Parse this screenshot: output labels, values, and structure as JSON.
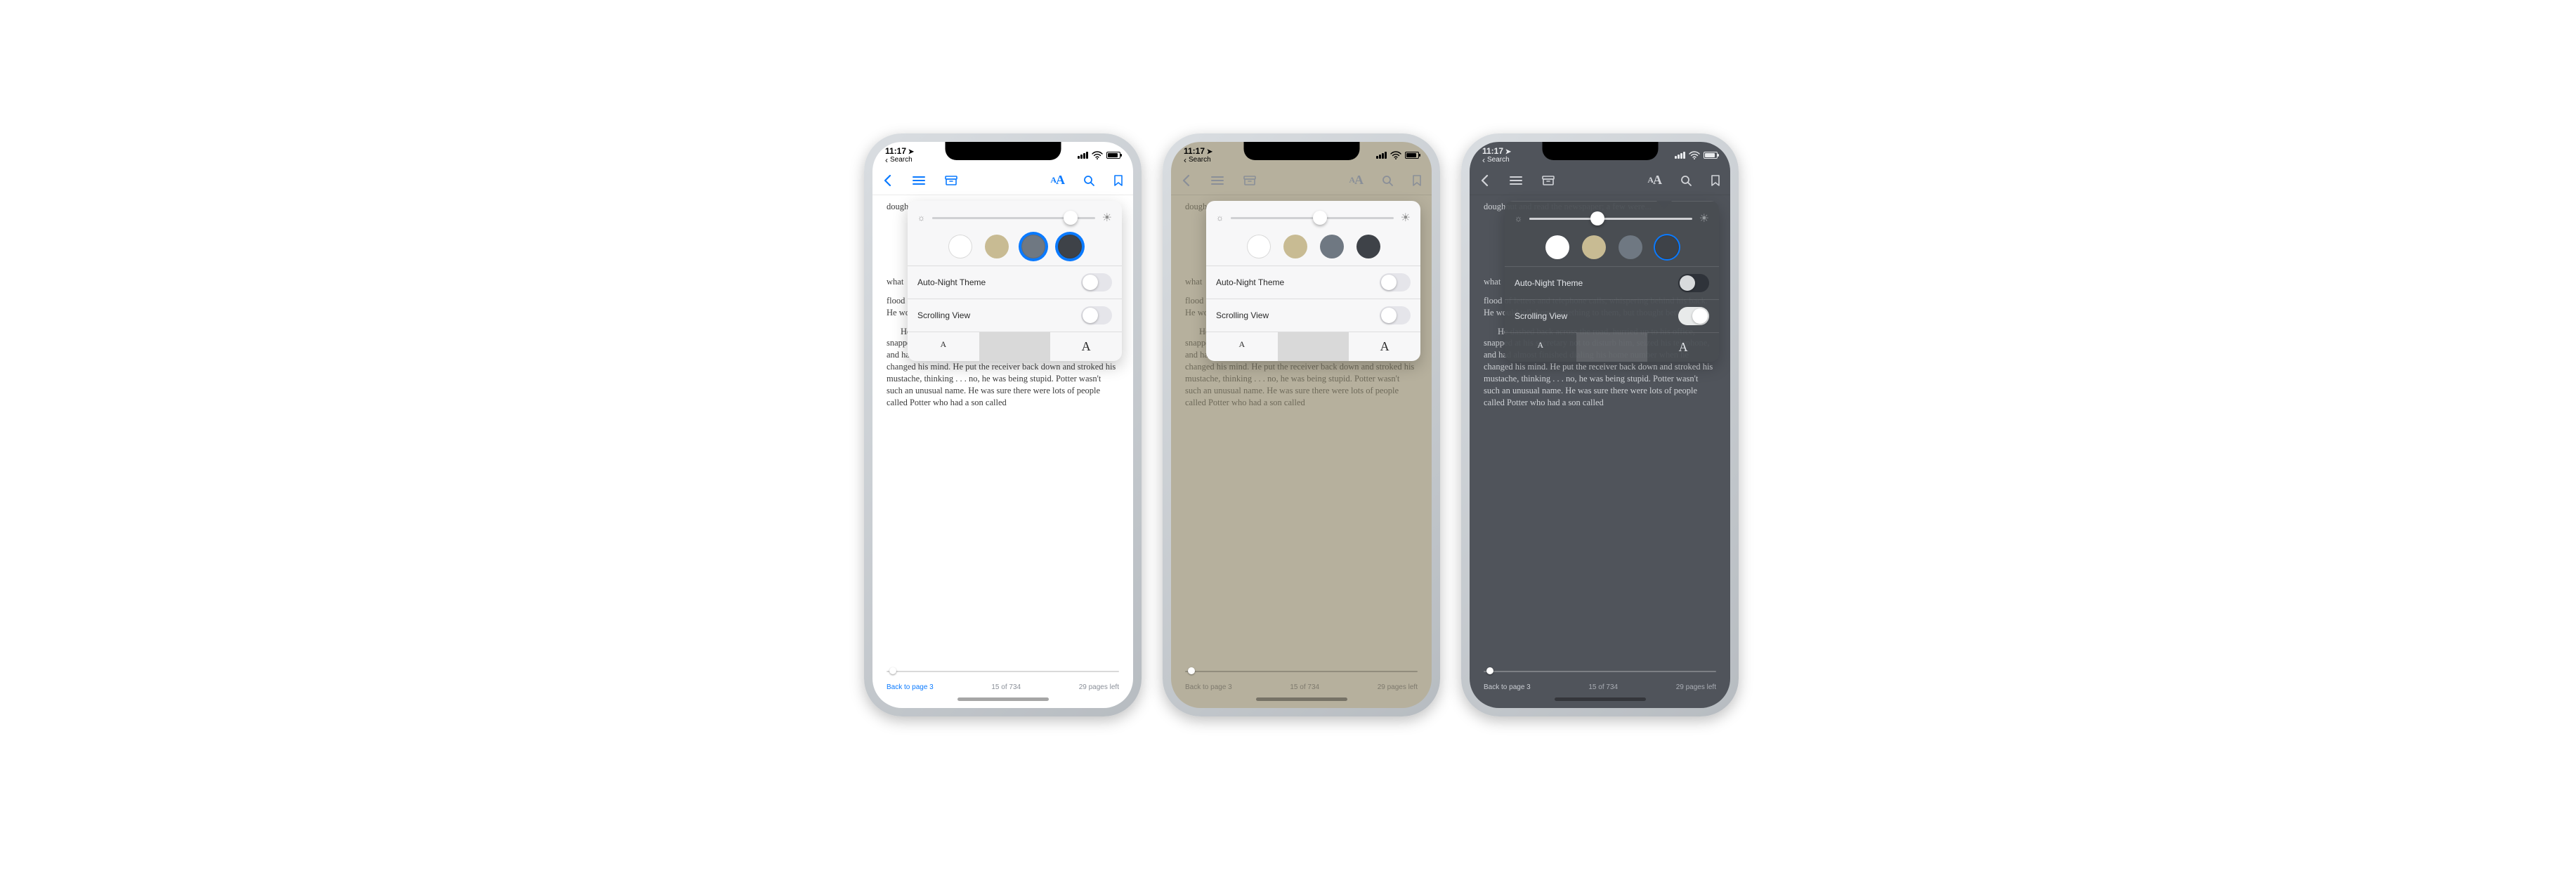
{
  "status_bar": {
    "time": "11:17",
    "breadcrumb": "Search",
    "has_location_arrow": true
  },
  "toolbar": {
    "back_icon": "chevron-left",
    "toc_icon": "list",
    "library_icon": "archive-box",
    "font_icon": "aA",
    "search_icon": "magnifying-glass",
    "bookmark_icon": "bookmark"
  },
  "popup": {
    "brightness_icon_small": "☼",
    "brightness_icon_large": "☀",
    "auto_night_label": "Auto-Night Theme",
    "scrolling_label": "Scrolling View",
    "font_small": "A",
    "font_large": "A"
  },
  "book_text": {
    "frag1": "doughnut and read the newspaper; a few were...",
    "whatline": "what",
    "p_after": "flood of letters and telephone calls, whispering behind his back. He would tell them something to them, but thought better of it.",
    "para2": "He dashed back across the road, hurried up to his office, snapped at his secretary not to disturb him, seized his telephone, and had almost finished dialing his home number when he changed his mind. He put the receiver back down and stroked his mustache, thinking . . . no, he was being stupid. Potter wasn't such an unusual name. He was sure there were lots of people called Potter who had a son called"
  },
  "footer": {
    "back_link": "Back to page 3",
    "page_of": "15 of 734",
    "pages_left": "29 pages left"
  },
  "phones": [
    {
      "theme": "light",
      "accent": "blue",
      "selected_swatch": 2,
      "ring_on": [
        2,
        3
      ],
      "brightness_pos": 0.85,
      "auto_night_on": false,
      "scrolling_on": false
    },
    {
      "theme": "sepia",
      "accent": "grey",
      "selected_swatch": null,
      "ring_on": [],
      "brightness_pos": 0.55,
      "auto_night_on": false,
      "scrolling_on": false
    },
    {
      "theme": "night",
      "accent": "white",
      "selected_swatch": 3,
      "ring_on": [
        3
      ],
      "brightness_pos": 0.42,
      "auto_night_on": false,
      "scrolling_on": true
    }
  ]
}
